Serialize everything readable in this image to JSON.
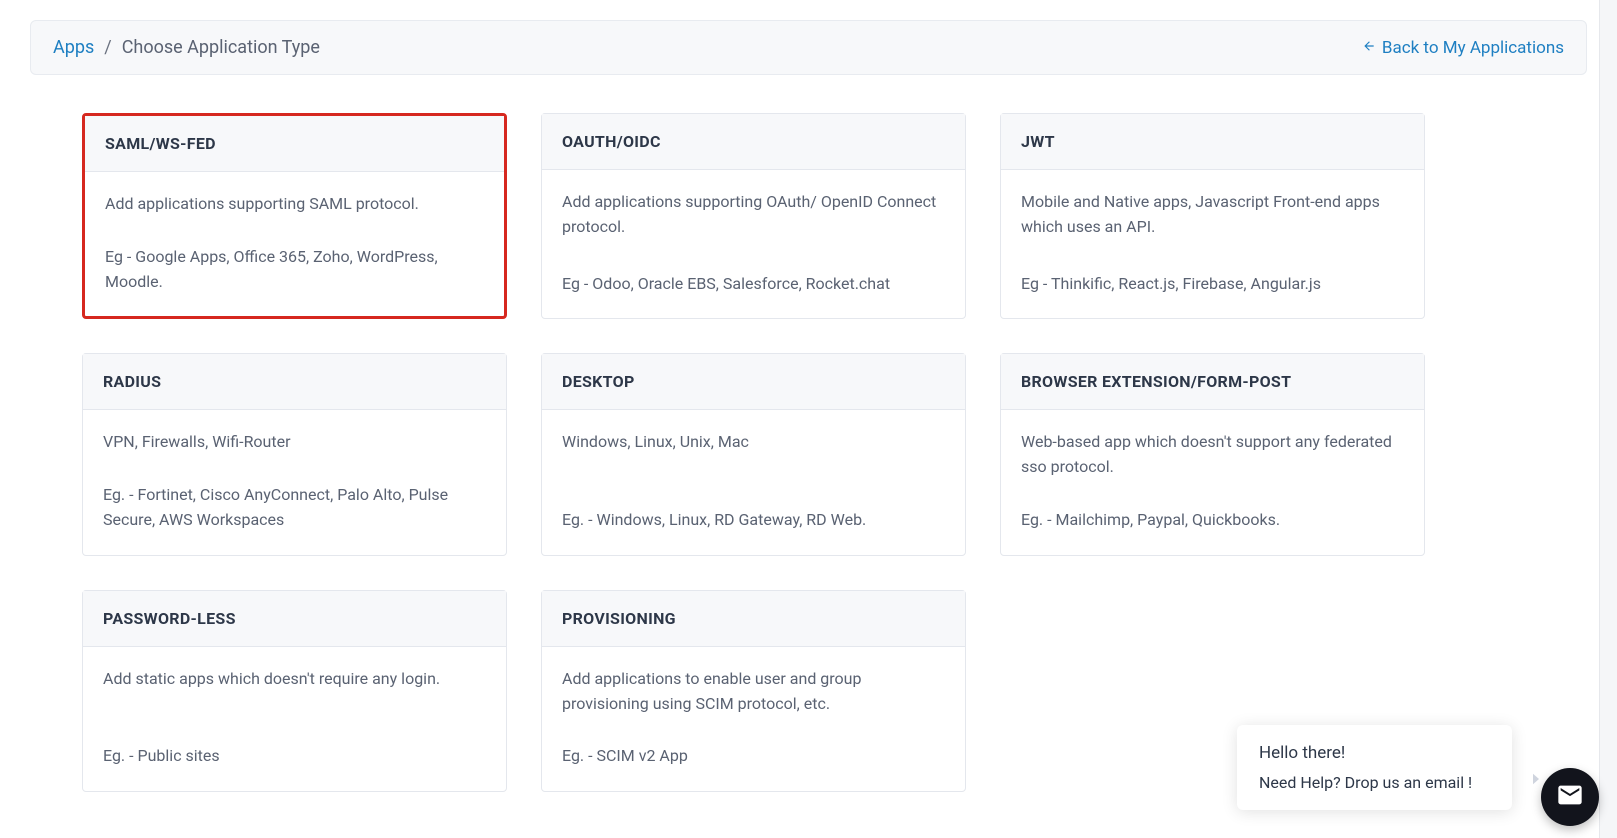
{
  "breadcrumb": {
    "apps_label": "Apps",
    "separator": "/",
    "current_label": "Choose Application Type"
  },
  "back_link": {
    "label": "Back to My Applications"
  },
  "cards": [
    {
      "title": "SAML/WS-FED",
      "description": "Add applications supporting SAML protocol.",
      "example": "Eg - Google Apps, Office 365, Zoho, WordPress, Moodle.",
      "highlighted": true
    },
    {
      "title": "OAUTH/OIDC",
      "description": "Add applications supporting OAuth/ OpenID Connect protocol.",
      "example": "Eg - Odoo, Oracle EBS, Salesforce, Rocket.chat",
      "highlighted": false
    },
    {
      "title": "JWT",
      "description": "Mobile and Native apps, Javascript Front-end apps which uses an API.",
      "example": "Eg - Thinkific, React.js, Firebase, Angular.js",
      "highlighted": false
    },
    {
      "title": "RADIUS",
      "description": "VPN, Firewalls, Wifi-Router",
      "example": "Eg. - Fortinet, Cisco AnyConnect, Palo Alto, Pulse Secure, AWS Workspaces",
      "highlighted": false
    },
    {
      "title": "DESKTOP",
      "description": "Windows, Linux, Unix, Mac",
      "example": "Eg. - Windows, Linux, RD Gateway, RD Web.",
      "highlighted": false
    },
    {
      "title": "BROWSER EXTENSION/FORM-POST",
      "description": "Web-based app which doesn't support any federated sso protocol.",
      "example": "Eg. - Mailchimp, Paypal, Quickbooks.",
      "highlighted": false
    },
    {
      "title": "PASSWORD-LESS",
      "description": "Add static apps which doesn't require any login.",
      "example": "Eg. - Public sites",
      "highlighted": false
    },
    {
      "title": "PROVISIONING",
      "description": "Add applications to enable user and group provisioning using SCIM protocol, etc.",
      "example": "Eg. - SCIM v2 App",
      "highlighted": false
    }
  ],
  "chat": {
    "line1": "Hello there!",
    "line2": "Need Help? Drop us an email !"
  }
}
